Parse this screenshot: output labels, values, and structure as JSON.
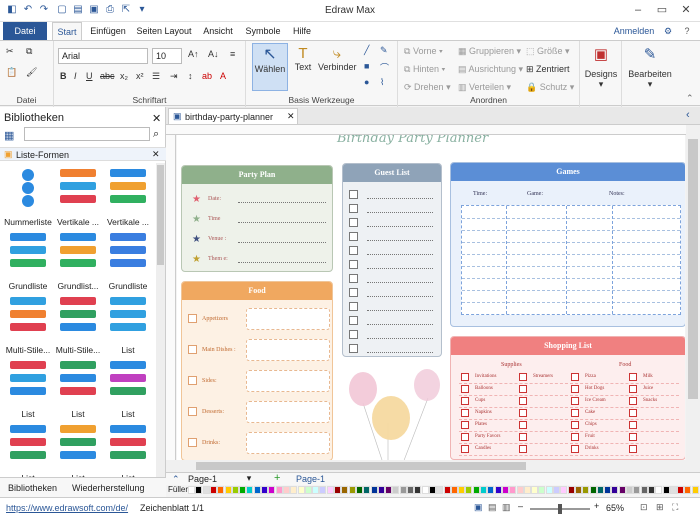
{
  "app": {
    "title": "Edraw Max",
    "login": "Anmelden"
  },
  "menu_tabs": [
    "Datei",
    "Start",
    "Einfügen",
    "Seiten Layout",
    "Ansicht",
    "Symbole",
    "Hilfe"
  ],
  "ribbon": {
    "groups": {
      "datei": "Datei",
      "schrift": "Schriftart",
      "werkzeuge": "Basis Werkzeuge",
      "anordnen": "Anordnen"
    },
    "font_name": "Arial",
    "font_size": "10",
    "tools": {
      "select": "Wählen",
      "text": "Text",
      "connector": "Verbinder"
    },
    "arrange": {
      "front": "Vorne",
      "back": "Hinten",
      "rotate": "Drehen",
      "group": "Gruppieren",
      "align": "Ausrichtung",
      "distribute": "Verteilen",
      "size": "Größe",
      "center": "Zentriert",
      "protect": "Schutz"
    },
    "styles": "Designs",
    "edit": "Bearbeiten"
  },
  "library": {
    "title": "Bibliotheken",
    "category": "Liste-Formen",
    "shapes": [
      "Nummerliste",
      "Vertikale ...",
      "Vertikale ...",
      "Grundliste",
      "Grundlist...",
      "Grundliste",
      "Multi-Stile...",
      "Multi-Stile...",
      "List",
      "List",
      "List",
      "List",
      "List",
      "List",
      "List"
    ],
    "footer_tabs": [
      "Bibliotheken",
      "Wiederherstellung"
    ]
  },
  "document": {
    "tab": "birthday-party-planner",
    "page_tab": "Page-1",
    "page_active": "Page-1",
    "fill_label": "Füller"
  },
  "planner": {
    "title": "Birthday Party Planner",
    "party_plan": {
      "title": "Party Plan",
      "rows": [
        "Date:",
        "Time",
        "Venue :",
        "Them e:"
      ]
    },
    "guest_list": {
      "title": "Guest List"
    },
    "games": {
      "title": "Games",
      "cols": [
        "Time:",
        "Game:",
        "Notes:"
      ]
    },
    "food": {
      "title": "Food",
      "rows": [
        "Appetizers",
        "Main Dishes :",
        "Sides:",
        "Desserts:",
        "Drinks:"
      ]
    },
    "shopping": {
      "title": "Shopping List",
      "supplies": "Supplies",
      "food": "Food",
      "col1": [
        "Invitations",
        "Balloons",
        "Cups",
        "Napkins",
        "Plates",
        "Party Favors",
        "Candles"
      ],
      "col2": [
        "Streamers",
        "",
        "",
        "",
        "",
        "",
        ""
      ],
      "col3": [
        "Pizza",
        "Hot Dogs",
        "Ice Cream",
        "Cake",
        "Chips",
        "Fruit",
        "Drinks"
      ],
      "col4": [
        "Milk",
        "Juice",
        "Snacks",
        "",
        "",
        "",
        ""
      ]
    }
  },
  "status": {
    "url": "https://www.edrawsoft.com/de/",
    "sheet": "Zeichenblatt 1/1",
    "zoom": "65%"
  },
  "colors": {
    "accent": "#2b5797",
    "party_plan": "#8fb08b",
    "guest": "#8fa3b8",
    "games": "#5b8ed6",
    "food": "#f0a860",
    "shopping": "#f08080"
  }
}
